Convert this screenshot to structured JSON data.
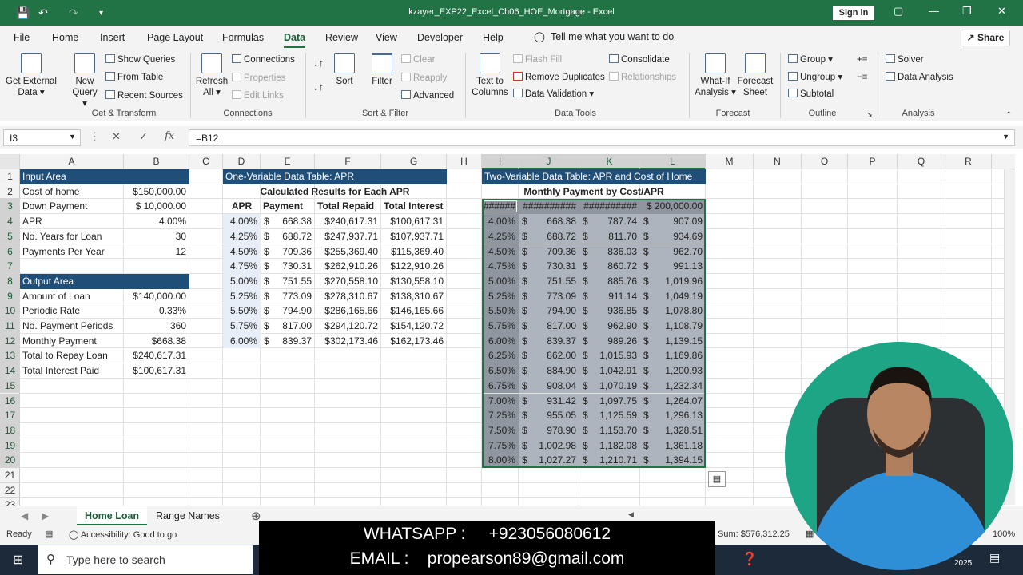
{
  "window": {
    "title": "kzayer_EXP22_Excel_Ch06_HOE_Mortgage - Excel",
    "signin": "Sign in"
  },
  "menu": [
    "File",
    "Home",
    "Insert",
    "Page Layout",
    "Formulas",
    "Data",
    "Review",
    "View",
    "Developer",
    "Help"
  ],
  "menu_active": "Data",
  "tell_me": "Tell me what you want to do",
  "share": "Share",
  "ribbon": {
    "get_external": "Get External Data",
    "new_query": "New Query",
    "show_queries": "Show Queries",
    "from_table": "From Table",
    "recent_sources": "Recent Sources",
    "grp_get": "Get & Transform",
    "refresh_all": "Refresh All",
    "connections": "Connections",
    "properties": "Properties",
    "edit_links": "Edit Links",
    "grp_conn": "Connections",
    "sort": "Sort",
    "filter": "Filter",
    "clear": "Clear",
    "reapply": "Reapply",
    "advanced": "Advanced",
    "grp_sort": "Sort & Filter",
    "text_to_columns": "Text to Columns",
    "flash_fill": "Flash Fill",
    "remove_duplicates": "Remove Duplicates",
    "data_validation": "Data Validation",
    "consolidate": "Consolidate",
    "relationships": "Relationships",
    "grp_tools": "Data Tools",
    "what_if": "What-If Analysis",
    "forecast_sheet": "Forecast Sheet",
    "grp_forecast": "Forecast",
    "group": "Group",
    "ungroup": "Ungroup",
    "subtotal": "Subtotal",
    "grp_outline": "Outline",
    "solver": "Solver",
    "data_analysis": "Data Analysis",
    "grp_analysis": "Analysis"
  },
  "namebox": "I3",
  "formula": "=B12",
  "columns": [
    "A",
    "B",
    "C",
    "D",
    "E",
    "F",
    "G",
    "H",
    "I",
    "J",
    "K",
    "L",
    "M",
    "N",
    "O",
    "P",
    "Q",
    "R"
  ],
  "rows": [
    "1",
    "2",
    "3",
    "4",
    "5",
    "6",
    "7",
    "8",
    "9",
    "10",
    "11",
    "12",
    "13",
    "14",
    "15",
    "16",
    "17",
    "18",
    "19",
    "20",
    "21",
    "22",
    "23"
  ],
  "input_area": {
    "header": "Input Area",
    "rows": [
      {
        "label": "Cost of home",
        "value": "$150,000.00"
      },
      {
        "label": "Down Payment",
        "value": "$  10,000.00"
      },
      {
        "label": "APR",
        "value": "4.00%"
      },
      {
        "label": "No. Years for Loan",
        "value": "30"
      },
      {
        "label": "Payments Per Year",
        "value": "12"
      }
    ]
  },
  "output_area": {
    "header": "Output Area",
    "rows": [
      {
        "label": "Amount of Loan",
        "value": "$140,000.00"
      },
      {
        "label": "Periodic Rate",
        "value": "0.33%"
      },
      {
        "label": "No. Payment Periods",
        "value": "360"
      },
      {
        "label": "Monthly Payment",
        "value": "$668.38"
      },
      {
        "label": "Total to Repay Loan",
        "value": "$240,617.31"
      },
      {
        "label": "Total Interest Paid",
        "value": "$100,617.31"
      }
    ]
  },
  "one_var": {
    "title": "One-Variable Data Table: APR",
    "subtitle": "Calculated Results for Each APR",
    "headers": [
      "APR",
      "Payment",
      "Total Repaid",
      "Total Interest"
    ],
    "rows": [
      [
        "4.00%",
        "668.38",
        "$240,617.31",
        "$100,617.31"
      ],
      [
        "4.25%",
        "688.72",
        "$247,937.71",
        "$107,937.71"
      ],
      [
        "4.50%",
        "709.36",
        "$255,369.40",
        "$115,369.40"
      ],
      [
        "4.75%",
        "730.31",
        "$262,910.26",
        "$122,910.26"
      ],
      [
        "5.00%",
        "751.55",
        "$270,558.10",
        "$130,558.10"
      ],
      [
        "5.25%",
        "773.09",
        "$278,310.67",
        "$138,310.67"
      ],
      [
        "5.50%",
        "794.90",
        "$286,165.66",
        "$146,165.66"
      ],
      [
        "5.75%",
        "817.00",
        "$294,120.72",
        "$154,120.72"
      ],
      [
        "6.00%",
        "839.37",
        "$302,173.46",
        "$162,173.46"
      ]
    ]
  },
  "two_var": {
    "title": "Two-Variable Data Table: APR and Cost of Home",
    "subtitle": "Monthly Payment by Cost/APR",
    "headers": [
      "######",
      "##########",
      "##########",
      "$ 200,000.00"
    ],
    "rows": [
      [
        "4.00%",
        "668.38",
        "787.74",
        "907.09"
      ],
      [
        "4.25%",
        "688.72",
        "811.70",
        "934.69"
      ],
      [
        "4.50%",
        "709.36",
        "836.03",
        "962.70"
      ],
      [
        "4.75%",
        "730.31",
        "860.72",
        "991.13"
      ],
      [
        "5.00%",
        "751.55",
        "885.76",
        "1,019.96"
      ],
      [
        "5.25%",
        "773.09",
        "911.14",
        "1,049.19"
      ],
      [
        "5.50%",
        "794.90",
        "936.85",
        "1,078.80"
      ],
      [
        "5.75%",
        "817.00",
        "962.90",
        "1,108.79"
      ],
      [
        "6.00%",
        "839.37",
        "989.26",
        "1,139.15"
      ],
      [
        "6.25%",
        "862.00",
        "1,015.93",
        "1,169.86"
      ],
      [
        "6.50%",
        "884.90",
        "1,042.91",
        "1,200.93"
      ],
      [
        "6.75%",
        "908.04",
        "1,070.19",
        "1,232.34"
      ],
      [
        "7.00%",
        "931.42",
        "1,097.75",
        "1,264.07"
      ],
      [
        "7.25%",
        "955.05",
        "1,125.59",
        "1,296.13"
      ],
      [
        "7.50%",
        "978.90",
        "1,153.70",
        "1,328.51"
      ],
      [
        "7.75%",
        "1,002.98",
        "1,182.08",
        "1,361.18"
      ],
      [
        "8.00%",
        "1,027.27",
        "1,210.71",
        "1,394.15"
      ]
    ]
  },
  "dollar": "$",
  "sheets": [
    "Home Loan",
    "Range Names"
  ],
  "status": {
    "ready": "Ready",
    "accessibility": "Accessibility: Good to go",
    "sum": "Sum: $576,312.25",
    "zoom": "100%"
  },
  "taskbar": {
    "search": "Type here to search",
    "year": "2025"
  },
  "overlay": {
    "line1": "WHATSAPP :     +923056080612",
    "line2": "EMAIL :    propearson89@gmail.com"
  },
  "colors": {
    "excel_green": "#217346",
    "header_blue": "#1f4e79",
    "webcam_bg": "#1ea585"
  }
}
